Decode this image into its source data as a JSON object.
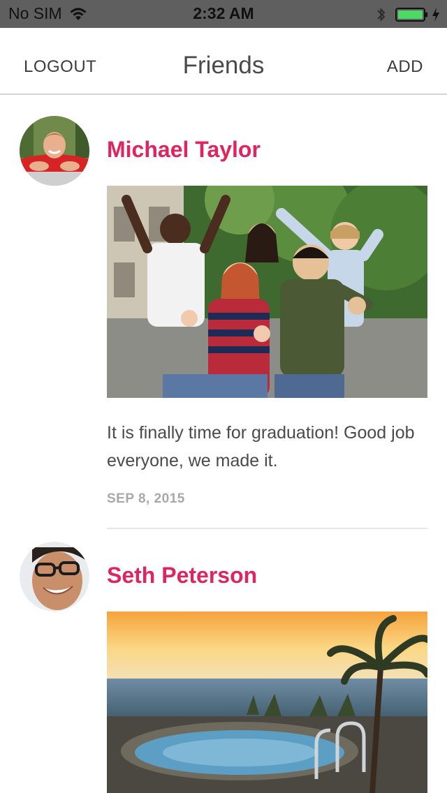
{
  "status_bar": {
    "carrier": "No SIM",
    "time": "2:32 AM",
    "battery_color": "#4cd964"
  },
  "nav": {
    "left_label": "LOGOUT",
    "title": "Friends",
    "right_label": "ADD"
  },
  "posts": [
    {
      "name": "Michael Taylor",
      "text": "It is finally time for graduation! Good job everyone, we made it.",
      "date": "SEP 8, 2015"
    },
    {
      "name": "Seth Peterson"
    }
  ],
  "colors": {
    "accent": "#e0245e",
    "text": "#4a4a4a",
    "muted": "#a8a8a8"
  }
}
